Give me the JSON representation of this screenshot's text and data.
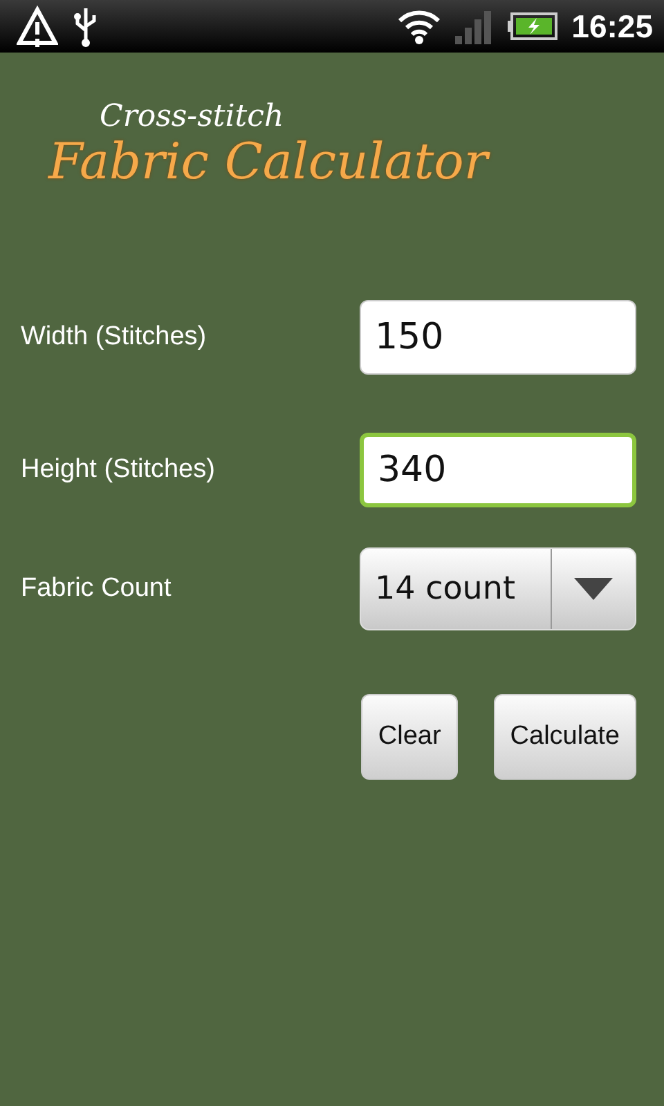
{
  "status_bar": {
    "time": "16:25",
    "charging": true
  },
  "logo": {
    "subtitle": "Cross-stitch",
    "title": "Fabric Calculator"
  },
  "fields": [
    {
      "label": "Width (Stitches)",
      "value": "150",
      "focused": false
    },
    {
      "label": "Height (Stitches)",
      "value": "340",
      "focused": true
    }
  ],
  "fabric_count": {
    "label": "Fabric Count",
    "value": "14 count"
  },
  "buttons": [
    {
      "label": "Clear"
    },
    {
      "label": "Calculate"
    }
  ]
}
